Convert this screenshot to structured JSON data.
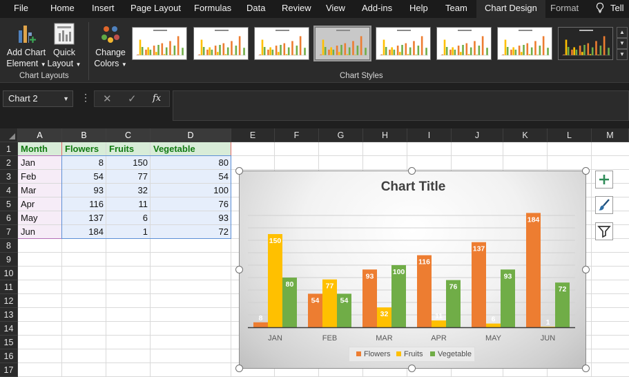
{
  "ribbon": {
    "tabs": [
      {
        "label": "File"
      },
      {
        "label": "Home"
      },
      {
        "label": "Insert"
      },
      {
        "label": "Page Layout"
      },
      {
        "label": "Formulas"
      },
      {
        "label": "Data"
      },
      {
        "label": "Review"
      },
      {
        "label": "View"
      },
      {
        "label": "Add-ins"
      },
      {
        "label": "Help"
      },
      {
        "label": "Team"
      },
      {
        "label": "Chart Design"
      },
      {
        "label": "Format"
      },
      {
        "label": "Tell"
      }
    ],
    "active_tab": "Chart Design",
    "buttons": {
      "add_chart_element": "Add Chart Element",
      "add_chart_element_l1": "Add Chart",
      "add_chart_element_l2": "Element",
      "quick_layout_l1": "Quick",
      "quick_layout_l2": "Layout",
      "change_colors_l1": "Change",
      "change_colors_l2": "Colors"
    },
    "groups": {
      "chart_layouts": "Chart Layouts",
      "chart_styles": "Chart Styles"
    },
    "selected_style_index": 3
  },
  "formula_bar": {
    "name_box": "Chart 2",
    "cancel_icon": "x-icon",
    "enter_icon": "check-icon",
    "function_icon": "fx-icon",
    "fx_label": "fx",
    "value": ""
  },
  "grid": {
    "columns": [
      "A",
      "B",
      "C",
      "D",
      "E",
      "F",
      "G",
      "H",
      "I",
      "J",
      "K",
      "L",
      "M"
    ],
    "rows": [
      "1",
      "2",
      "3",
      "4",
      "5",
      "6",
      "7",
      "8",
      "9",
      "10",
      "11",
      "12",
      "13",
      "14",
      "15",
      "16",
      "17"
    ],
    "table": {
      "headers": [
        "Month",
        "Flowers",
        "Fruits",
        "Vegetable"
      ],
      "rows": [
        [
          "Jan",
          "8",
          "150",
          "80"
        ],
        [
          "Feb",
          "54",
          "77",
          "54"
        ],
        [
          "Mar",
          "93",
          "32",
          "100"
        ],
        [
          "Apr",
          "116",
          "11",
          "76"
        ],
        [
          "May",
          "137",
          "6",
          "93"
        ],
        [
          "Jun",
          "184",
          "1",
          "72"
        ]
      ]
    }
  },
  "colors": {
    "flowers": "#ed7d31",
    "fruits": "#ffc000",
    "vegetable": "#70ad47",
    "header_text": "#117a11",
    "header_fill": "#d8ecd8",
    "values_fill": "#e6eefb",
    "months_fill": "#f6ecf7"
  },
  "chart_data": {
    "type": "bar",
    "title": "Chart Title",
    "categories": [
      "JAN",
      "FEB",
      "MAR",
      "APR",
      "MAY",
      "JUN"
    ],
    "series": [
      {
        "name": "Flowers",
        "values": [
          8,
          54,
          93,
          116,
          137,
          184
        ],
        "color": "#ed7d31"
      },
      {
        "name": "Fruits",
        "values": [
          150,
          77,
          32,
          11,
          6,
          1
        ],
        "color": "#ffc000"
      },
      {
        "name": "Vegetable",
        "values": [
          80,
          54,
          100,
          76,
          93,
          72
        ],
        "color": "#70ad47"
      }
    ],
    "ylim": [
      0,
      200
    ],
    "grid": true,
    "data_labels": true,
    "legend": "bottom",
    "xlabel": "",
    "ylabel": ""
  },
  "chart_tools": {
    "elements_icon": "plus-icon",
    "styles_icon": "brush-icon",
    "filters_icon": "funnel-icon"
  }
}
